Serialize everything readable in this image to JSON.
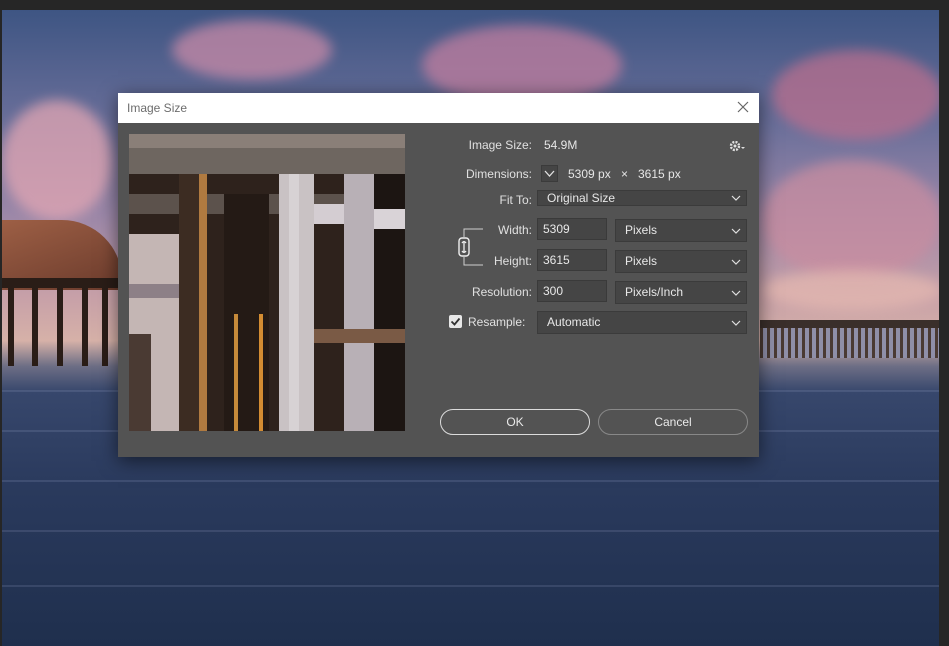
{
  "dialog": {
    "title": "Image Size",
    "close_icon": "close-icon",
    "image_size": {
      "label": "Image Size:",
      "value": "54.9M"
    },
    "settings_icon": "gear-icon",
    "dimensions": {
      "label": "Dimensions:",
      "width": "5309 px",
      "times": "×",
      "height": "3615 px"
    },
    "fit_to": {
      "label": "Fit To:",
      "value": "Original Size"
    },
    "width": {
      "label": "Width:",
      "value": "5309",
      "unit": "Pixels"
    },
    "height": {
      "label": "Height:",
      "value": "3615",
      "unit": "Pixels"
    },
    "resolution": {
      "label": "Resolution:",
      "value": "300",
      "unit": "Pixels/Inch"
    },
    "resample": {
      "label": "Resample:",
      "checked": true,
      "value": "Automatic"
    },
    "ok_label": "OK",
    "cancel_label": "Cancel"
  },
  "colors": {
    "dialog_bg": "#535353",
    "field_bg": "#454545",
    "titlebar_bg": "#ffffff"
  }
}
